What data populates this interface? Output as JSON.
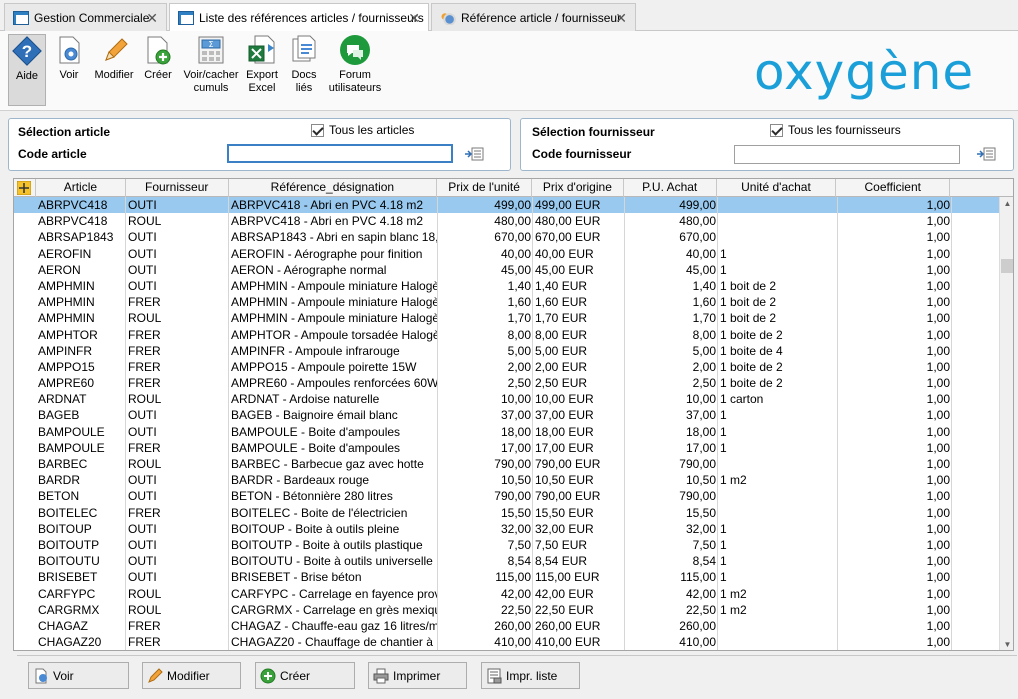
{
  "tabs": [
    {
      "label": "Gestion Commerciale",
      "icon": "grid-window-icon",
      "active": false
    },
    {
      "label": "Liste des références articles / fournisseurs",
      "icon": "grid-window-icon",
      "active": true
    },
    {
      "label": "Référence article / fournisseur",
      "icon": "gear-window-icon",
      "active": false
    }
  ],
  "toolbar": {
    "buttons": [
      {
        "line1": "Aide",
        "line2": "",
        "icon": "help-icon"
      },
      {
        "line1": "Voir",
        "line2": "",
        "icon": "view-icon"
      },
      {
        "line1": "Modifier",
        "line2": "",
        "icon": "pencil-icon"
      },
      {
        "line1": "Créer",
        "line2": "",
        "icon": "create-icon"
      },
      {
        "line1": "Voir/cacher",
        "line2": "cumuls",
        "icon": "sum-icon"
      },
      {
        "line1": "Export",
        "line2": "Excel",
        "icon": "excel-icon"
      },
      {
        "line1": "Docs",
        "line2": "liés",
        "icon": "documents-icon"
      },
      {
        "line1": "Forum",
        "line2": "utilisateurs",
        "icon": "forum-icon"
      }
    ],
    "logo": "oxygène"
  },
  "article_selection": {
    "title": "Sélection article",
    "all_label": "Tous les articles",
    "all_checked": true,
    "code_label": "Code article",
    "code_value": ""
  },
  "supplier_selection": {
    "title": "Sélection fournisseur",
    "all_label": "Tous les fournisseurs",
    "all_checked": true,
    "code_label": "Code fournisseur",
    "code_value": ""
  },
  "table": {
    "columns": [
      "Article",
      "Fournisseur",
      "Référence_désignation",
      "Prix de l'unité",
      "Prix d'origine",
      "P.U. Achat",
      "Unité d'achat",
      "Coefficient"
    ],
    "rows": [
      [
        "ABRPVC418",
        "OUTI",
        "ABRPVC418 - Abri en PVC 4.18 m2",
        "499,00",
        "499,00 EUR",
        "499,00",
        "",
        "1,00"
      ],
      [
        "ABRPVC418",
        "ROUL",
        "ABRPVC418 - Abri en PVC 4.18 m2",
        "480,00",
        "480,00 EUR",
        "480,00",
        "",
        "1,00"
      ],
      [
        "ABRSAP1843",
        "OUTI",
        "ABRSAP1843 - Abri en sapin blanc 18,",
        "670,00",
        "670,00 EUR",
        "670,00",
        "",
        "1,00"
      ],
      [
        "AEROFIN",
        "OUTI",
        "AEROFIN - Aérographe pour finition",
        "40,00",
        "40,00 EUR",
        "40,00",
        "1",
        "1,00"
      ],
      [
        "AERON",
        "OUTI",
        "AERON - Aérographe normal",
        "45,00",
        "45,00 EUR",
        "45,00",
        "1",
        "1,00"
      ],
      [
        "AMPHMIN",
        "OUTI",
        "AMPHMIN - Ampoule miniature Halogè",
        "1,40",
        "1,40 EUR",
        "1,40",
        "1 boit de 2",
        "1,00"
      ],
      [
        "AMPHMIN",
        "FRER",
        "AMPHMIN - Ampoule miniature Halogè",
        "1,60",
        "1,60 EUR",
        "1,60",
        "1 boit de 2",
        "1,00"
      ],
      [
        "AMPHMIN",
        "ROUL",
        "AMPHMIN - Ampoule miniature Halogè",
        "1,70",
        "1,70 EUR",
        "1,70",
        "1 boit de 2",
        "1,00"
      ],
      [
        "AMPHTOR",
        "FRER",
        "AMPHTOR - Ampoule torsadée Halogè",
        "8,00",
        "8,00 EUR",
        "8,00",
        "1 boite de 2",
        "1,00"
      ],
      [
        "AMPINFR",
        "FRER",
        "AMPINFR - Ampoule infrarouge",
        "5,00",
        "5,00 EUR",
        "5,00",
        "1 boite de 4",
        "1,00"
      ],
      [
        "AMPPO15",
        "FRER",
        "AMPPO15 - Ampoule poirette 15W",
        "2,00",
        "2,00 EUR",
        "2,00",
        "1 boite de 2",
        "1,00"
      ],
      [
        "AMPRE60",
        "FRER",
        "AMPRE60 - Ampoules renforcées 60W",
        "2,50",
        "2,50 EUR",
        "2,50",
        "1 boite de 2",
        "1,00"
      ],
      [
        "ARDNAT",
        "ROUL",
        "ARDNAT - Ardoise naturelle",
        "10,00",
        "10,00 EUR",
        "10,00",
        "1 carton",
        "1,00"
      ],
      [
        "BAGEB",
        "OUTI",
        "BAGEB - Baignoire émail blanc",
        "37,00",
        "37,00 EUR",
        "37,00",
        "1",
        "1,00"
      ],
      [
        "BAMPOULE",
        "OUTI",
        "BAMPOULE - Boite d'ampoules",
        "18,00",
        "18,00 EUR",
        "18,00",
        "1",
        "1,00"
      ],
      [
        "BAMPOULE",
        "FRER",
        "BAMPOULE - Boite d'ampoules",
        "17,00",
        "17,00 EUR",
        "17,00",
        "1",
        "1,00"
      ],
      [
        "BARBEC",
        "ROUL",
        "BARBEC - Barbecue gaz avec hotte",
        "790,00",
        "790,00 EUR",
        "790,00",
        "",
        "1,00"
      ],
      [
        "BARDR",
        "OUTI",
        "BARDR - Bardeaux rouge",
        "10,50",
        "10,50 EUR",
        "10,50",
        "1 m2",
        "1,00"
      ],
      [
        "BETON",
        "OUTI",
        "BETON - Bétonnière 280 litres",
        "790,00",
        "790,00 EUR",
        "790,00",
        "",
        "1,00"
      ],
      [
        "BOITELEC",
        "FRER",
        "BOITELEC - Boite de l'électricien",
        "15,50",
        "15,50 EUR",
        "15,50",
        "",
        "1,00"
      ],
      [
        "BOITOUP",
        "OUTI",
        "BOITOUP - Boite à outils pleine",
        "32,00",
        "32,00 EUR",
        "32,00",
        "1",
        "1,00"
      ],
      [
        "BOITOUTP",
        "OUTI",
        "BOITOUTP - Boite à outils plastique",
        "7,50",
        "7,50 EUR",
        "7,50",
        "1",
        "1,00"
      ],
      [
        "BOITOUTU",
        "OUTI",
        "BOITOUTU - Boite à outils universelle",
        "8,54",
        "8,54 EUR",
        "8,54",
        "1",
        "1,00"
      ],
      [
        "BRISEBET",
        "OUTI",
        "BRISEBET - Brise béton",
        "115,00",
        "115,00 EUR",
        "115,00",
        "1",
        "1,00"
      ],
      [
        "CARFYPC",
        "ROUL",
        "CARFYPC - Carrelage en fayence prov",
        "42,00",
        "42,00 EUR",
        "42,00",
        "1 m2",
        "1,00"
      ],
      [
        "CARGRMX",
        "ROUL",
        "CARGRMX - Carrelage en grès mexiqu",
        "22,50",
        "22,50 EUR",
        "22,50",
        "1 m2",
        "1,00"
      ],
      [
        "CHAGAZ",
        "FRER",
        "CHAGAZ - Chauffe-eau gaz 16 litres/m",
        "260,00",
        "260,00 EUR",
        "260,00",
        "",
        "1,00"
      ],
      [
        "CHAGAZ20",
        "FRER",
        "CHAGAZ20 - Chauffage de chantier à",
        "410,00",
        "410,00 EUR",
        "410,00",
        "",
        "1,00"
      ]
    ],
    "selected_row": 0
  },
  "bottom_buttons": [
    {
      "label": "Voir",
      "icon": "view-icon"
    },
    {
      "label": "Modifier",
      "icon": "pencil-icon"
    },
    {
      "label": "Créer",
      "icon": "add-icon"
    },
    {
      "label": "Imprimer",
      "icon": "printer-icon"
    },
    {
      "label": "Impr. liste",
      "icon": "print-list-icon"
    }
  ]
}
